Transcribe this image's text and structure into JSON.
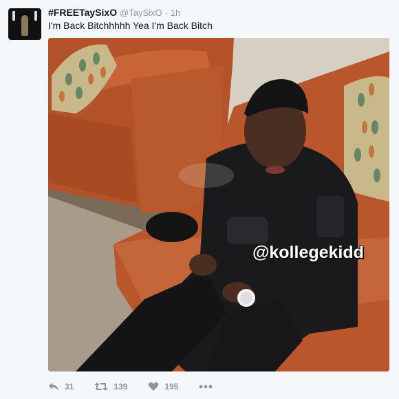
{
  "tweet": {
    "display_name": "#FREETaySixO",
    "handle": "@TaySixO",
    "separator": "·",
    "time": "1h",
    "text": "I'm Back Bitchhhhh Yea I'm Back Bitch"
  },
  "media": {
    "watermark": "@kollegekidd"
  },
  "actions": {
    "reply_count": "31",
    "retweet_count": "139",
    "like_count": "195"
  },
  "colors": {
    "text": "#14171a",
    "secondary": "#8899a6",
    "background": "#f5f8fa"
  }
}
